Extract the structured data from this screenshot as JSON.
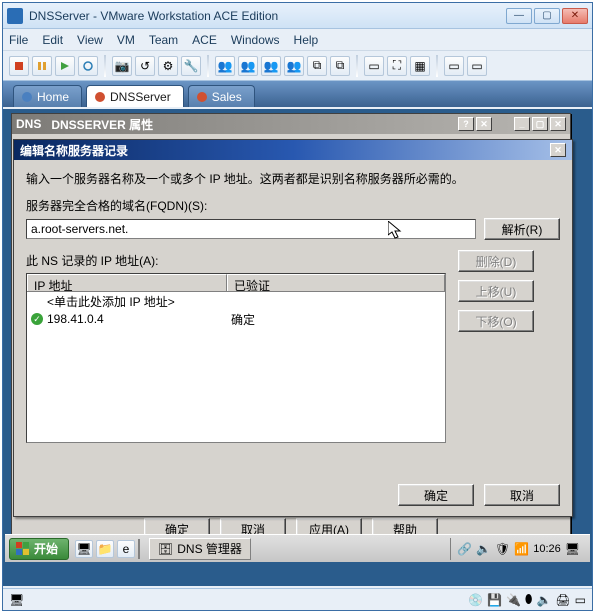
{
  "title": "DNSServer - VMware Workstation ACE Edition",
  "menu": [
    "File",
    "Edit",
    "View",
    "VM",
    "Team",
    "ACE",
    "Windows",
    "Help"
  ],
  "tabs": [
    {
      "label": "Home",
      "icon": "home"
    },
    {
      "label": "DNSServer",
      "icon": "vm",
      "active": true
    },
    {
      "label": "Sales",
      "icon": "vm"
    }
  ],
  "inner_window": {
    "title": "DNSSERVER 属性",
    "prefix": "DNS",
    "buttons": {
      "ok": "确定",
      "cancel": "取消",
      "apply": "应用(A)",
      "help": "帮助"
    }
  },
  "dialog": {
    "title": "编辑名称服务器记录",
    "instruction": "输入一个服务器名称及一个或多个 IP 地址。这两者都是识别名称服务器所必需的。",
    "fqdn_label": "服务器完全合格的域名(FQDN)(S):",
    "fqdn_value": "a.root-servers.net.",
    "resolve": "解析(R)",
    "ip_list_label": "此 NS 记录的 IP 地址(A):",
    "columns": {
      "ip": "IP 地址",
      "validated": "已验证"
    },
    "hint_row": "<单击此处添加 IP 地址>",
    "rows": [
      {
        "ip": "198.41.0.4",
        "status": "确定"
      }
    ],
    "side_buttons": {
      "delete": "删除(D)",
      "up": "上移(U)",
      "down": "下移(O)"
    },
    "ok": "确定",
    "cancel": "取消"
  },
  "taskbar": {
    "start": "开始",
    "task": "DNS 管理器",
    "clock": "10:26"
  }
}
